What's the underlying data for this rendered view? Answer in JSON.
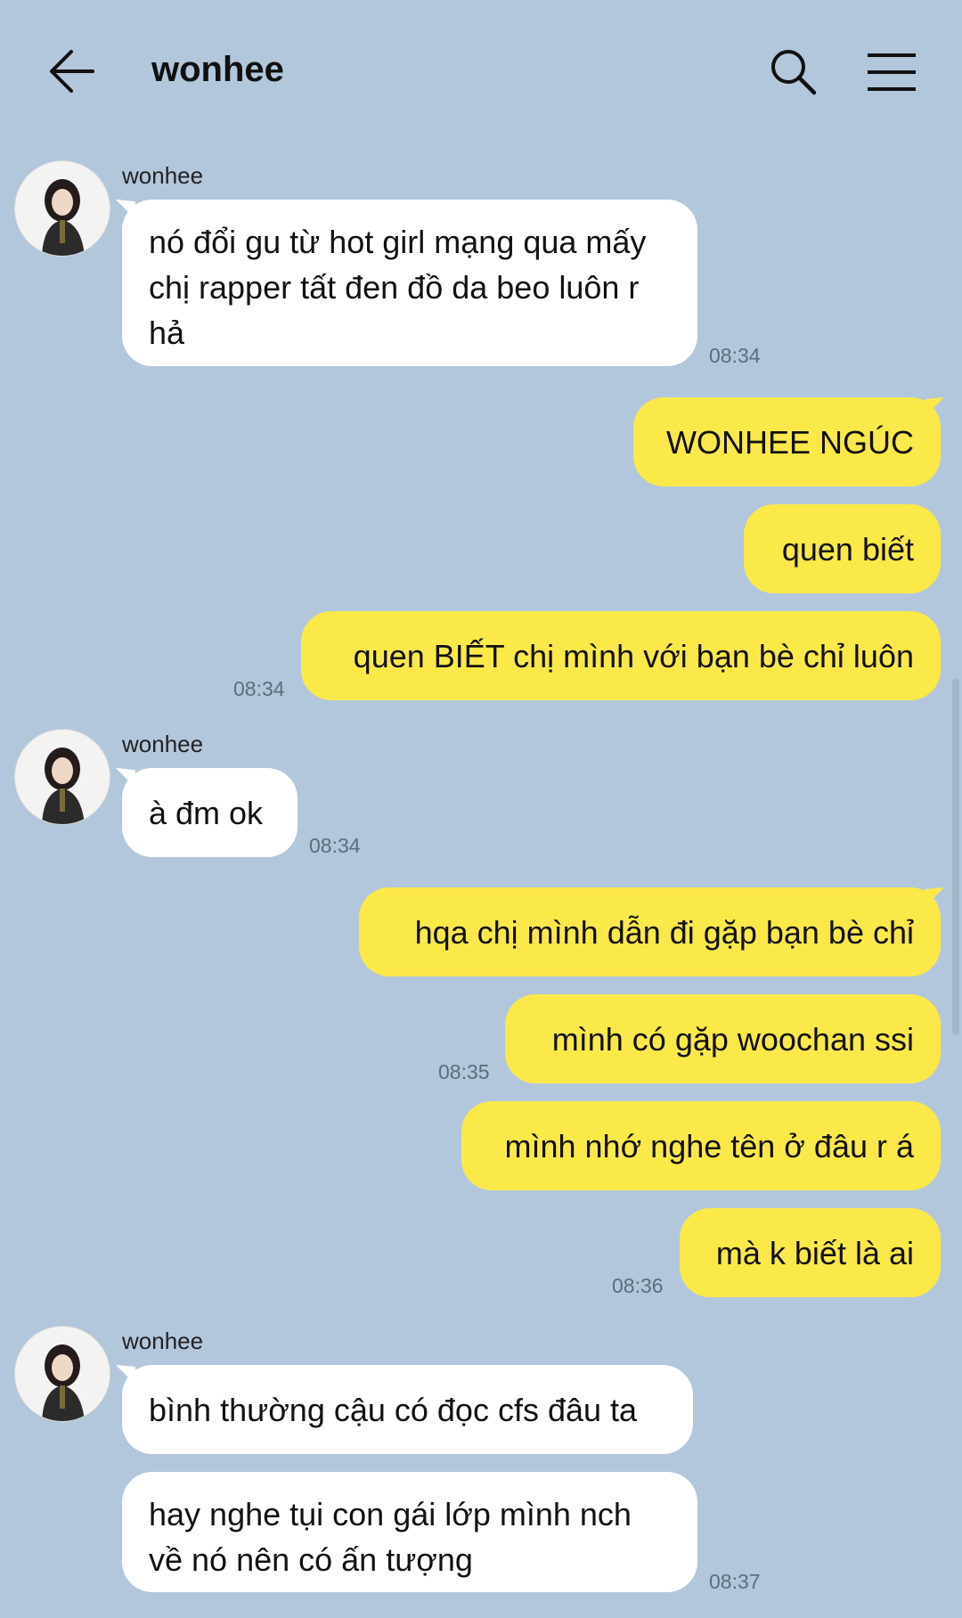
{
  "header": {
    "title": "wonhee",
    "back_icon": "arrow-left-icon",
    "search_icon": "search-icon",
    "menu_icon": "hamburger-menu-icon"
  },
  "colors": {
    "background": "#b2c7dc",
    "incoming_bubble": "#ffffff",
    "outgoing_bubble": "#fbe94a"
  },
  "messages": [
    {
      "group": 1,
      "sender": "wonhee",
      "text": "nó đổi gu từ hot girl mạng qua mấy chị rapper tất đen đồ da beo luôn r hả",
      "time": "08:34"
    },
    {
      "group": 2,
      "text": "WONHEE NGÚC"
    },
    {
      "group": 2,
      "text": "quen biết"
    },
    {
      "group": 2,
      "text": "quen BIẾT chị mình với bạn bè chỉ luôn",
      "time": "08:34"
    },
    {
      "group": 3,
      "sender": "wonhee",
      "text": "à đm ok",
      "time": "08:34"
    },
    {
      "group": 4,
      "text": "hqa chị mình dẫn đi gặp bạn bè chỉ"
    },
    {
      "group": 4,
      "text": "mình có gặp woochan ssi",
      "time": "08:35"
    },
    {
      "group": 4,
      "text": "mình nhớ nghe tên ở đâu r á"
    },
    {
      "group": 4,
      "text": "mà k biết là ai",
      "time": "08:36"
    },
    {
      "group": 5,
      "sender": "wonhee",
      "text": "bình thường cậu có đọc cfs đâu ta"
    },
    {
      "group": 5,
      "text": "hay nghe tụi con gái lớp mình nch về nó nên có ấn tượng",
      "time": "08:37"
    }
  ]
}
